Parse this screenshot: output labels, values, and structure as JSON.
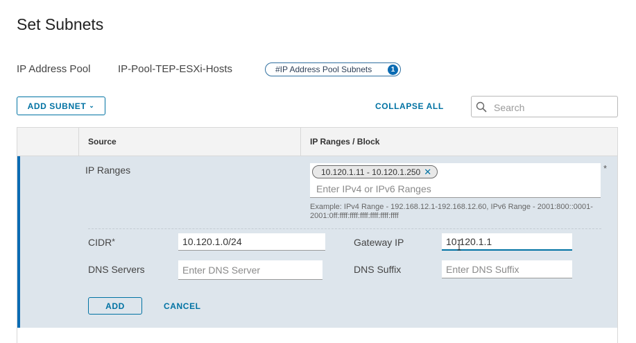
{
  "page": {
    "title": "Set Subnets"
  },
  "pool": {
    "label": "IP Address Pool",
    "value": "IP-Pool-TEP-ESXi-Hosts",
    "chip_label": "#IP Address Pool Subnets",
    "chip_count": "1"
  },
  "toolbar": {
    "add_subnet_label": "ADD SUBNET",
    "collapse_all_label": "COLLAPSE ALL",
    "search_placeholder": "Search"
  },
  "grid": {
    "columns": [
      "Source",
      "IP Ranges / Block"
    ]
  },
  "form": {
    "ip_ranges_label": "IP Ranges",
    "ip_ranges_chip": "10.120.1.11 - 10.120.1.250",
    "ip_ranges_placeholder": "Enter IPv4 or IPv6 Ranges",
    "required_mark": "*",
    "example_text": "Example: IPv4 Range - 192.168.12.1-192.168.12.60, IPv6 Range - 2001:800::0001-2001:0ff:ffff:ffff:ffff:ffff:ffff:ffff",
    "cidr_label": "CIDR",
    "cidr_value": "10.120.1.0/24",
    "gateway_label": "Gateway IP",
    "gateway_value": "10.120.1.1",
    "dns_servers_label": "DNS Servers",
    "dns_servers_placeholder": "Enter DNS Server",
    "dns_suffix_label": "DNS Suffix",
    "dns_suffix_placeholder": "Enter DNS Suffix",
    "add_label": "ADD",
    "cancel_label": "CANCEL"
  },
  "colors": {
    "accent": "#0072a3",
    "expanded_bg": "#dde5ec",
    "badge": "#0a6bb3"
  },
  "icons": {
    "search": "search-icon",
    "remove_chip": "close-icon",
    "dropdown": "chevron-down-icon"
  }
}
